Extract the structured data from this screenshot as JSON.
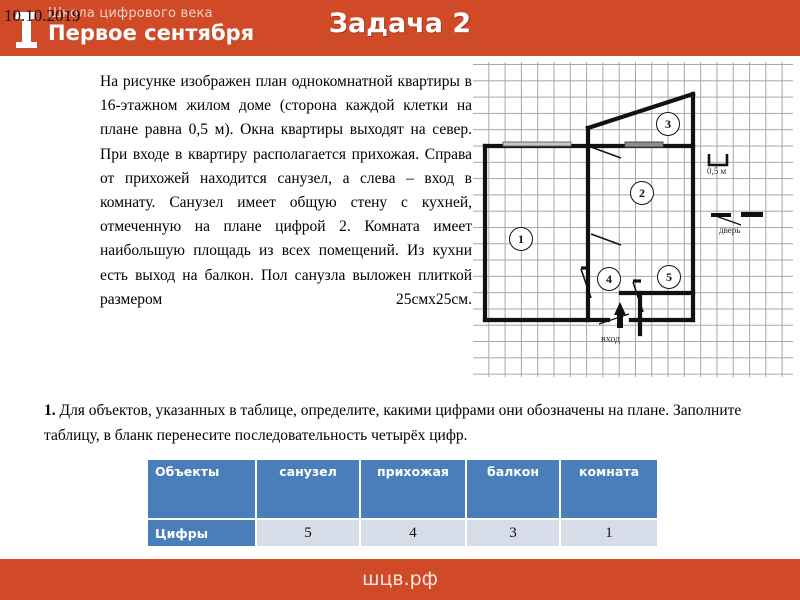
{
  "header": {
    "brand_line1": "Школа цифрового века",
    "brand_line2": "Первое сентября",
    "date_stamp": "10.10.2019",
    "title": "Задача 2",
    "bg_color": "#d04a28"
  },
  "problem": {
    "text": "На рисунке изображен план однокомнатной квартиры в 16-этажном жилом доме (сторона каждой клетки на плане равна 0,5 м). Окна квартиры выходят на север. При входе в квартиру располагается прихожая. Справа от прихожей находится санузел, а слева – вход в комнату. Санузел имеет общую стену с кухней, отмеченную на плане цифрой 2. Комната имеет наибольшую площадь из всех помещений. Из кухни есть выход на балкон. Пол санузла выложен плиткой размером 25смх25см."
  },
  "question": {
    "number": "1.",
    "text": "Для объектов, указанных в таблице, определите, какими цифрами они обозначены на плане. Заполните таблицу, в бланк перенесите последовательность четырёх цифр."
  },
  "plan": {
    "scale_label": "0,5 м",
    "door_label": "дверь",
    "entrance_label": "вход",
    "room_numbers": [
      "1",
      "2",
      "3",
      "4",
      "5"
    ]
  },
  "table": {
    "headers": [
      "Объекты",
      "санузел",
      "прихожая",
      "балкон",
      "комната"
    ],
    "row_label": "Цифры",
    "values": [
      "5",
      "4",
      "3",
      "1"
    ],
    "header_color": "#4a7ebb",
    "cell_color": "#d6dce8"
  },
  "footer": {
    "site": "шцв.рф",
    "bg_color": "#d04a28"
  }
}
